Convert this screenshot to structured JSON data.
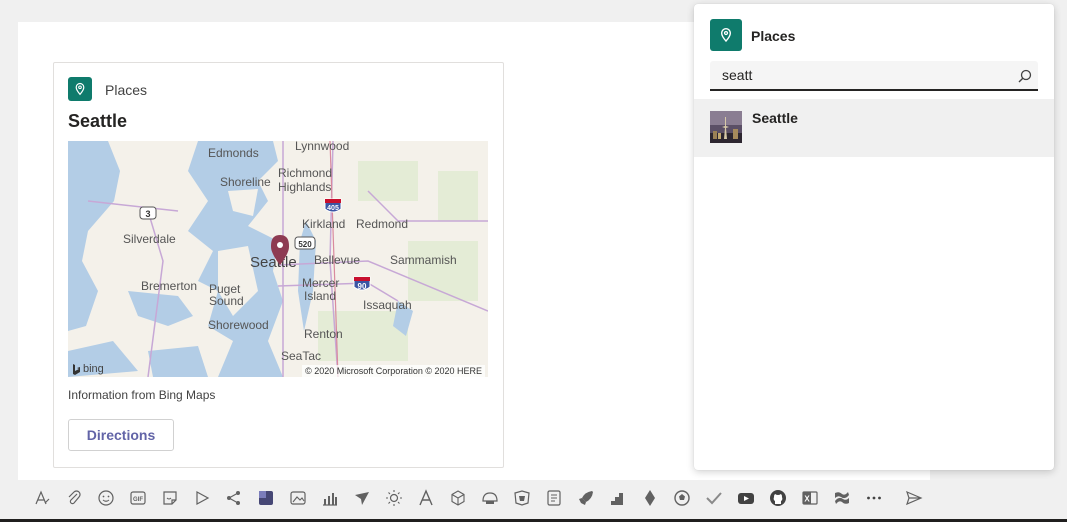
{
  "card": {
    "app_name": "Places",
    "title": "Seattle",
    "info": "Information from Bing Maps",
    "directions_label": "Directions",
    "map": {
      "attribution": "© 2020 Microsoft Corporation © 2020 HERE",
      "provider": "bing",
      "places": {
        "edmonds": "Edmonds",
        "lynnwood": "Lynnwood",
        "shoreline": "Shoreline",
        "richmond": "Richmond",
        "highlands": "Highlands",
        "kirkland": "Kirkland",
        "redmond": "Redmond",
        "silverdale": "Silverdale",
        "seattle": "Seattle",
        "bellevue": "Bellevue",
        "sammamish": "Sammamish",
        "bremerton": "Bremerton",
        "puget": "Puget",
        "sound": "Sound",
        "mercer": "Mercer",
        "island": "Island",
        "issaquah": "Issaquah",
        "shorewood": "Shorewood",
        "renton": "Renton",
        "seatac": "SeaTac"
      },
      "shields": {
        "hwy3": "3",
        "i405": "405",
        "sr520": "520",
        "i90": "90"
      }
    }
  },
  "panel": {
    "title": "Places",
    "search": {
      "value": "seatt",
      "placeholder": ""
    },
    "results": [
      {
        "label": "Seattle"
      }
    ]
  },
  "toolbar": {
    "icons": [
      "format-icon",
      "attach-icon",
      "emoji-icon",
      "gif-icon",
      "sticker-icon",
      "meet-now-icon",
      "loop-icon",
      "app-tile-icon",
      "image-icon",
      "chart-icon",
      "plane-icon",
      "sun-icon",
      "text-a-icon",
      "cube-icon",
      "helmet-icon",
      "cart-icon",
      "notes-icon",
      "rocket-icon",
      "stairs-icon",
      "diamond-icon",
      "soccer-icon",
      "check-icon",
      "youtube-icon",
      "github-icon",
      "office-icon",
      "confluence-icon",
      "more-icon"
    ],
    "send_icon": "send-icon"
  },
  "colors": {
    "accent": "#0f7b6c",
    "brand": "#6264a7",
    "pin": "#8e3b52"
  }
}
